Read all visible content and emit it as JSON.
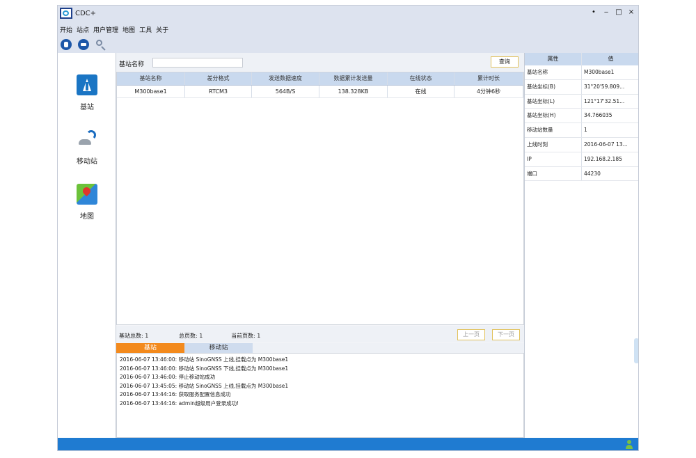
{
  "window": {
    "title": "CDC+",
    "controls": {
      "minimize": "‒",
      "restore": "□",
      "close": "×",
      "skin": "•"
    }
  },
  "menu": [
    "开始",
    "站点",
    "用户管理",
    "地图",
    "工具",
    "关于"
  ],
  "toolbar": [
    {
      "name": "connect-icon"
    },
    {
      "name": "disconnect-icon"
    },
    {
      "name": "search-icon"
    }
  ],
  "nav": [
    {
      "id": "base",
      "label": "基站",
      "icon": "tower-icon"
    },
    {
      "id": "rover",
      "label": "移动站",
      "icon": "rover-icon"
    },
    {
      "id": "map",
      "label": "地图",
      "icon": "map-icon"
    }
  ],
  "search": {
    "label": "基站名称",
    "value": "",
    "placeholder": "",
    "button": "查询"
  },
  "table": {
    "columns": [
      "基站名称",
      "差分格式",
      "发送数据速度",
      "数据累计发送量",
      "在线状态",
      "累计时长"
    ],
    "rows": [
      [
        "M300base1",
        "RTCM3",
        "564B/S",
        "138.328KB",
        "在线",
        "4分钟6秒"
      ]
    ]
  },
  "pager": {
    "total_label": "基站总数: 1",
    "pages_label": "总页数: 1",
    "current_label": "当前页数: 1",
    "prev": "上一页",
    "next": "下一页"
  },
  "log_tabs": [
    "基站",
    "移动站"
  ],
  "logs": [
    "2016-06-07 13:46:00: 移动站 SinoGNSS 上线,挂载点为 M300base1",
    "2016-06-07 13:46:00: 移动站 SinoGNSS 下线,挂载点为 M300base1",
    "2016-06-07 13:46:00: 停止移动站成功",
    "2016-06-07 13:45:05: 移动站 SinoGNSS 上线,挂载点为 M300base1",
    "2016-06-07 13:44:16: 获取服务配置信息成功",
    "2016-06-07 13:44:16: admin超级用户登录成功!"
  ],
  "properties": {
    "header": {
      "key": "属性",
      "value": "值"
    },
    "rows": [
      {
        "key": "基站名称",
        "value": "M300base1"
      },
      {
        "key": "基站坐标(B)",
        "value": "31°20'59.809..."
      },
      {
        "key": "基站坐标(L)",
        "value": "121°17'32.51..."
      },
      {
        "key": "基站坐标(H)",
        "value": "34.766035"
      },
      {
        "key": "移动站数量",
        "value": "1"
      },
      {
        "key": "上线时刻",
        "value": "2016-06-07 13..."
      },
      {
        "key": "IP",
        "value": "192.168.2.185"
      },
      {
        "key": "端口",
        "value": "44230"
      }
    ]
  },
  "colors": {
    "accent_tab": "#f38a1d",
    "status_bar": "#1f7bd1",
    "header_bg": "#c9d9ee",
    "button_border": "#e2c25b"
  }
}
